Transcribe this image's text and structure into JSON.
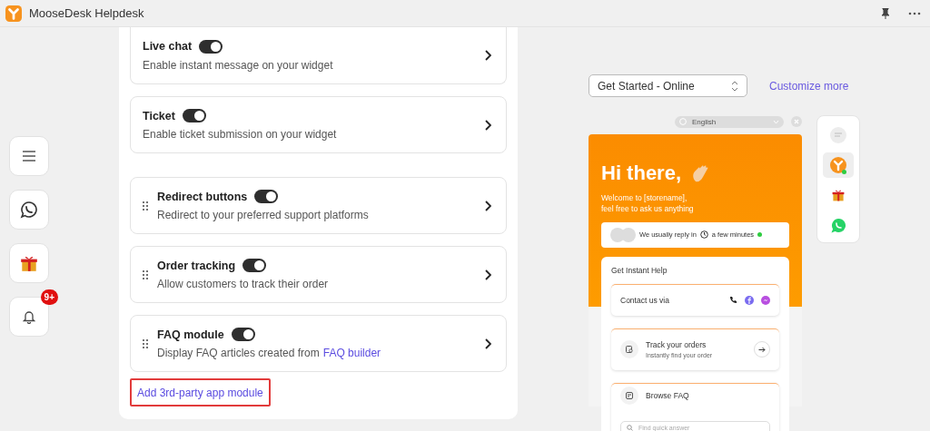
{
  "window": {
    "title": "MooseDesk Helpdesk"
  },
  "sidebar": {
    "items": [
      {
        "kind": "menu"
      },
      {
        "kind": "whatsapp"
      },
      {
        "kind": "gift"
      },
      {
        "kind": "bell",
        "badge": "9+"
      }
    ]
  },
  "modules": [
    {
      "kind": "fixed",
      "title": "Live chat",
      "on": true,
      "description": "Enable instant message on your widget"
    },
    {
      "kind": "fixed",
      "title": "Ticket",
      "on": true,
      "description": "Enable ticket submission on your widget"
    },
    {
      "kind": "sortable",
      "title": "Redirect buttons",
      "on": true,
      "description": "Redirect to your preferred support platforms"
    },
    {
      "kind": "sortable",
      "title": "Order tracking",
      "on": true,
      "description": "Allow customers to track their order"
    },
    {
      "kind": "sortable",
      "title": "FAQ module",
      "on": true,
      "description": "Display FAQ articles created from ",
      "link": "FAQ builder"
    }
  ],
  "add_module_link": "Add 3rd-party app module",
  "preview": {
    "select": {
      "value": "Get Started - Online"
    },
    "customize_link": "Customize more",
    "language": "English",
    "widget": {
      "heading": "Hi there,",
      "greeting_lines": [
        "Welcome to [storename],",
        "feel free to ask us anything"
      ],
      "reply_prefix": "We usually reply in",
      "reply_time": "a few minutes",
      "help_title": "Get Instant Help",
      "contact_label": "Contact us via",
      "track": {
        "title": "Track your orders",
        "subtitle": "Instantly find your order"
      },
      "faq": {
        "title": "Browse FAQ",
        "placeholder": "Find quick answer"
      }
    },
    "launcher": [
      {
        "kind": "chat",
        "selected": false
      },
      {
        "kind": "logo",
        "selected": true
      },
      {
        "kind": "gift",
        "selected": false
      },
      {
        "kind": "whatsapp",
        "selected": false
      }
    ]
  }
}
